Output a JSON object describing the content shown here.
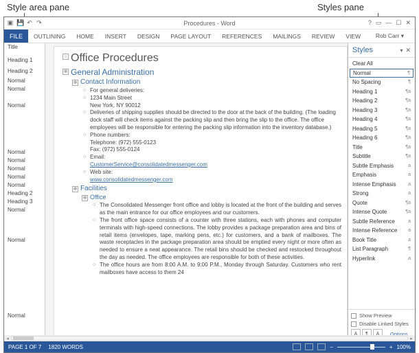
{
  "annotations": {
    "left": "Style area pane",
    "right": "Styles pane"
  },
  "titlebar": {
    "doc_title": "Procedures - Word",
    "user": "Rob Carr"
  },
  "ribbon": {
    "file": "FILE",
    "tabs": [
      "OUTLINING",
      "HOME",
      "INSERT",
      "DESIGN",
      "PAGE LAYOUT",
      "REFERENCES",
      "MAILINGS",
      "REVIEW",
      "VIEW"
    ]
  },
  "style_area": {
    "rows": [
      {
        "label": "Title",
        "gap": 7
      },
      {
        "label": "Heading 1",
        "gap": 4
      },
      {
        "label": "Heading 2",
        "gap": 2
      },
      {
        "label": "Normal",
        "gap": 0
      },
      {
        "label": "Normal",
        "gap": 12
      },
      {
        "label": "Normal",
        "gap": 56
      },
      {
        "label": "Normal",
        "gap": 0
      },
      {
        "label": "Normal",
        "gap": 0
      },
      {
        "label": "Normal",
        "gap": 0
      },
      {
        "label": "Normal",
        "gap": 0
      },
      {
        "label": "Normal",
        "gap": 0
      },
      {
        "label": "Heading 2",
        "gap": 0
      },
      {
        "label": "Heading 3",
        "gap": 0
      },
      {
        "label": "Normal",
        "gap": 32
      },
      {
        "label": "Normal",
        "gap": 98
      },
      {
        "label": "Normal",
        "gap": 0
      }
    ]
  },
  "document": {
    "title": "Office Procedures",
    "h1": "General Administration",
    "h2a": "Contact Information",
    "b1": "For general deliveries:",
    "b2a": "1234 Main Street",
    "b2b": "New York, NY  90012",
    "b3": "Deliveries of shipping supplies should be directed to the door at the back of the building. (The loading dock staff will check items against the packing slip and then bring the slip to the office. The office employees will be responsible for entering the packing slip information into the inventory database.)",
    "b4": "Phone numbers:",
    "b4a": "Telephone: (972) 555-0123",
    "b4b": "Fax: (972) 555-0124",
    "b5": "Email:",
    "b5a": "CustomerService@consolidatedmessenger.com",
    "b6": "Web site:",
    "b6a": "www.consolidatedmessenger.com",
    "h2b": "Facilities",
    "h3a": "Office",
    "o1": "The Consolidated Messenger front office and lobby is located at the front of the building and serves as the main entrance for our office employees and our customers.",
    "o2": "The front office space consists of a counter with three stations, each with phones and computer terminals with high-speed connections. The lobby provides a package preparation area and bins of retail items (envelopes, tape, marking pens, etc.) for customers, and a bank of mailboxes. The waste receptacles in the package preparation area should be emptied every night or more often as needed to ensure a neat appearance. The retail bins should be checked and restocked throughout the day as needed. The office employees are responsible for both of these activities.",
    "o3": "The office hours are from 8:00 A.M. to 9:00 P.M., Monday through Saturday. Customers who rent mailboxes have access to them 24"
  },
  "styles_pane": {
    "title": "Styles",
    "clear": "Clear All",
    "items": [
      {
        "name": "Normal",
        "sym": "¶",
        "sel": true
      },
      {
        "name": "No Spacing",
        "sym": "¶"
      },
      {
        "name": "Heading 1",
        "sym": "¶a"
      },
      {
        "name": "Heading 2",
        "sym": "¶a"
      },
      {
        "name": "Heading 3",
        "sym": "¶a"
      },
      {
        "name": "Heading 4",
        "sym": "¶a"
      },
      {
        "name": "Heading 5",
        "sym": "¶a"
      },
      {
        "name": "Heading 6",
        "sym": "¶a"
      },
      {
        "name": "Title",
        "sym": "¶a"
      },
      {
        "name": "Subtitle",
        "sym": "¶a"
      },
      {
        "name": "Subtle Emphasis",
        "sym": "a"
      },
      {
        "name": "Emphasis",
        "sym": "a"
      },
      {
        "name": "Intense Emphasis",
        "sym": "a"
      },
      {
        "name": "Strong",
        "sym": "a"
      },
      {
        "name": "Quote",
        "sym": "¶a"
      },
      {
        "name": "Intense Quote",
        "sym": "¶a"
      },
      {
        "name": "Subtle Reference",
        "sym": "a"
      },
      {
        "name": "Intense Reference",
        "sym": "a"
      },
      {
        "name": "Book Title",
        "sym": "a"
      },
      {
        "name": "List Paragraph",
        "sym": "¶"
      },
      {
        "name": "Hyperlink",
        "sym": "a"
      }
    ],
    "show_preview": "Show Preview",
    "disable_linked": "Disable Linked Styles",
    "options": "Options..."
  },
  "status": {
    "page": "PAGE 1 OF 7",
    "words": "1820 WORDS",
    "zoom": "100%"
  }
}
